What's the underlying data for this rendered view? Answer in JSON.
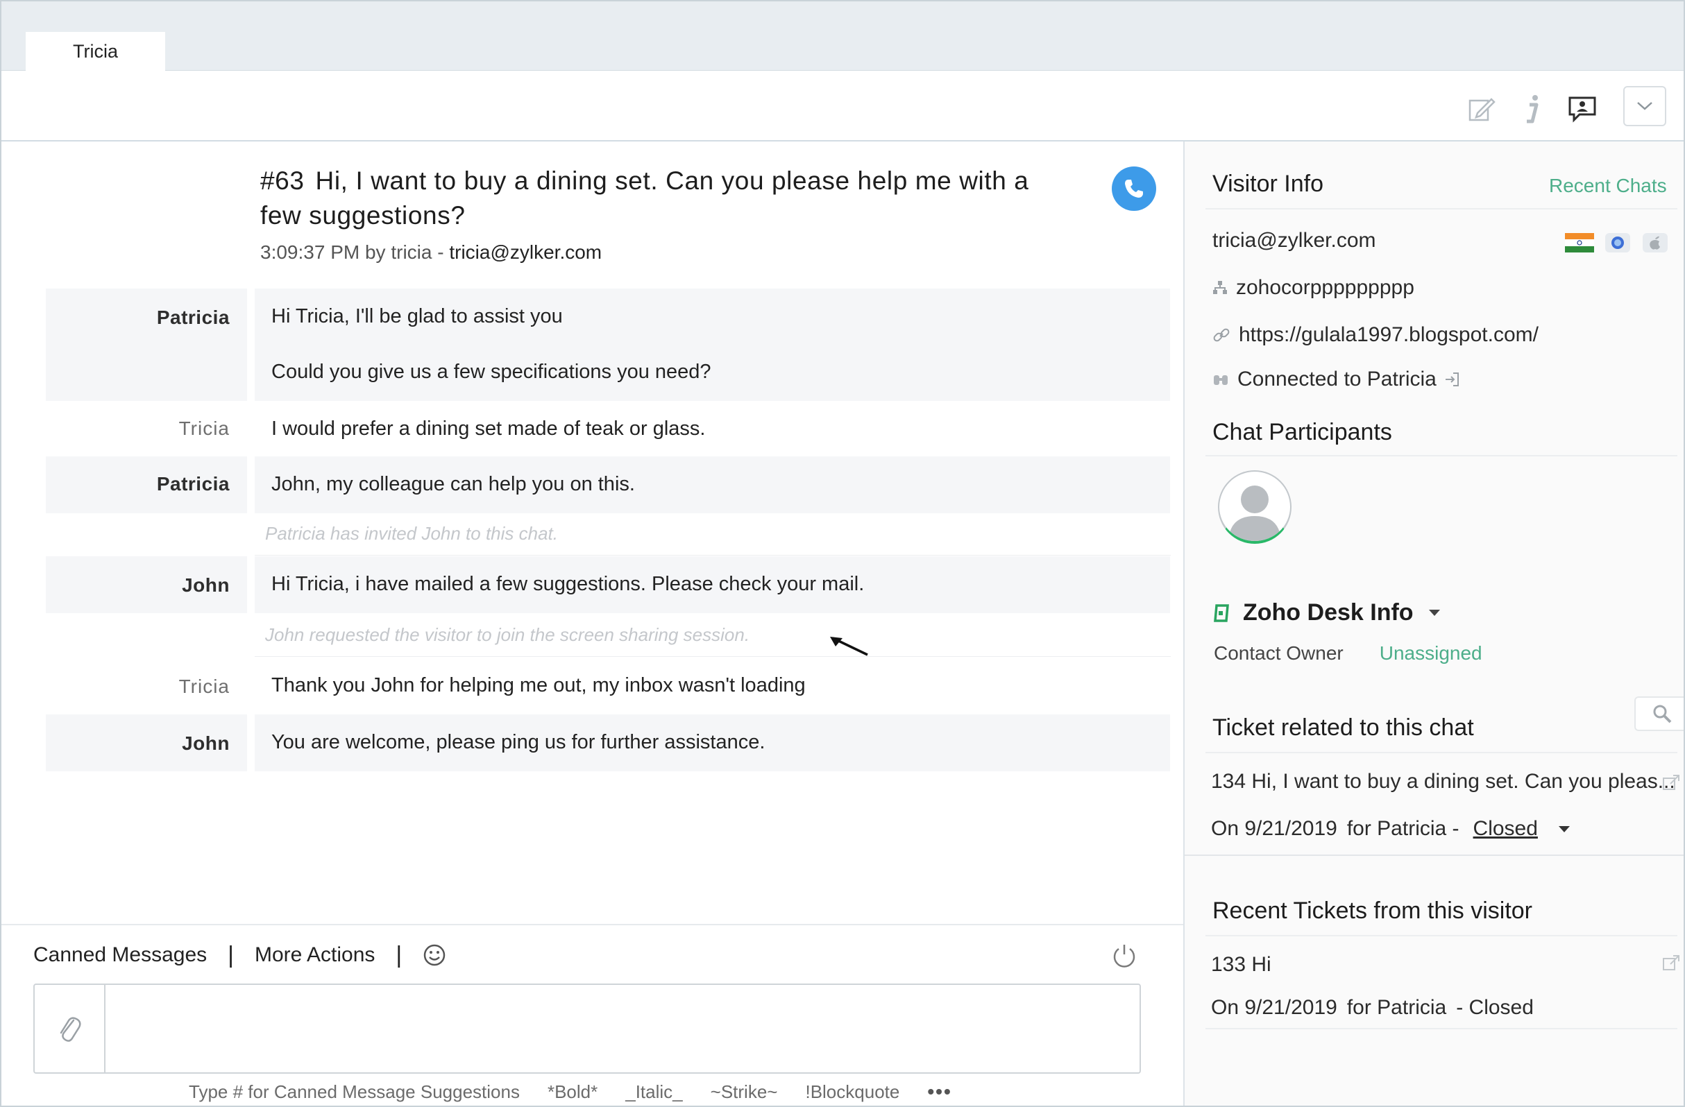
{
  "window": {
    "tab_title": "Tricia"
  },
  "toolbar": {
    "icons": [
      "edit-icon",
      "info-icon",
      "chat-bubble-icon",
      "chevron-down-icon"
    ]
  },
  "chat": {
    "number": "#63",
    "question": "Hi, I want to buy a dining set. Can you please help me with a few suggestions?",
    "time": "3:09:37 PM",
    "by_text": "by tricia -",
    "email": "tricia@zylker.com",
    "messages": [
      {
        "sender": "Patricia",
        "lines": [
          "Hi Tricia, I'll be glad to assist you",
          "Could you give us a few specifications you need?"
        ]
      },
      {
        "sender": "Tricia",
        "lines": [
          "I would prefer a dining set made of teak or glass."
        ]
      },
      {
        "sender": "Patricia",
        "lines": [
          "John, my colleague can help you on this."
        ]
      },
      {
        "sender": "John",
        "lines": [
          "Hi Tricia, i have mailed a few suggestions. Please check your mail."
        ]
      },
      {
        "sender": "Tricia",
        "lines": [
          "Thank you John for helping me out, my inbox wasn't loading"
        ]
      },
      {
        "sender": "John",
        "lines": [
          "You are welcome, please ping us for further assistance."
        ]
      }
    ],
    "system_messages": [
      "Patricia has invited John to this chat.",
      "John requested the visitor to join the screen sharing session."
    ]
  },
  "composer": {
    "canned_label": "Canned Messages",
    "more_actions_label": "More Actions",
    "separator": "|",
    "hints": [
      "Type # for Canned Message Suggestions",
      "*Bold*",
      "_Italic_",
      "~Strike~",
      "!Blockquote"
    ],
    "more_dots": "•••"
  },
  "sidebar": {
    "visitor_info_title": "Visitor Info",
    "recent_chats_link": "Recent Chats",
    "email": "tricia@zylker.com",
    "company": "zohocorppppppppp",
    "url": "https://gulala1997.blogspot.com/",
    "connected": "Connected to Patricia",
    "participants_title": "Chat Participants",
    "zoho_title": "Zoho Desk Info",
    "contact_owner_label": "Contact Owner",
    "contact_owner_value": "Unassigned",
    "ticket_title": "Ticket related to this chat",
    "ticket_subject": "134 Hi, I want to buy a dining set. Can you pleas...",
    "ticket_date": "On 9/21/2019",
    "ticket_for": "for Patricia -",
    "ticket_status": "Closed",
    "recent_title": "Recent Tickets from this visitor",
    "recent_subject": "133 Hi",
    "recent_date": "On 9/21/2019",
    "recent_for": "for Patricia",
    "recent_status": "- Closed"
  },
  "colors": {
    "accent_green": "#4dae8a",
    "call_blue": "#3d9be9",
    "online_green": "#29b868"
  }
}
